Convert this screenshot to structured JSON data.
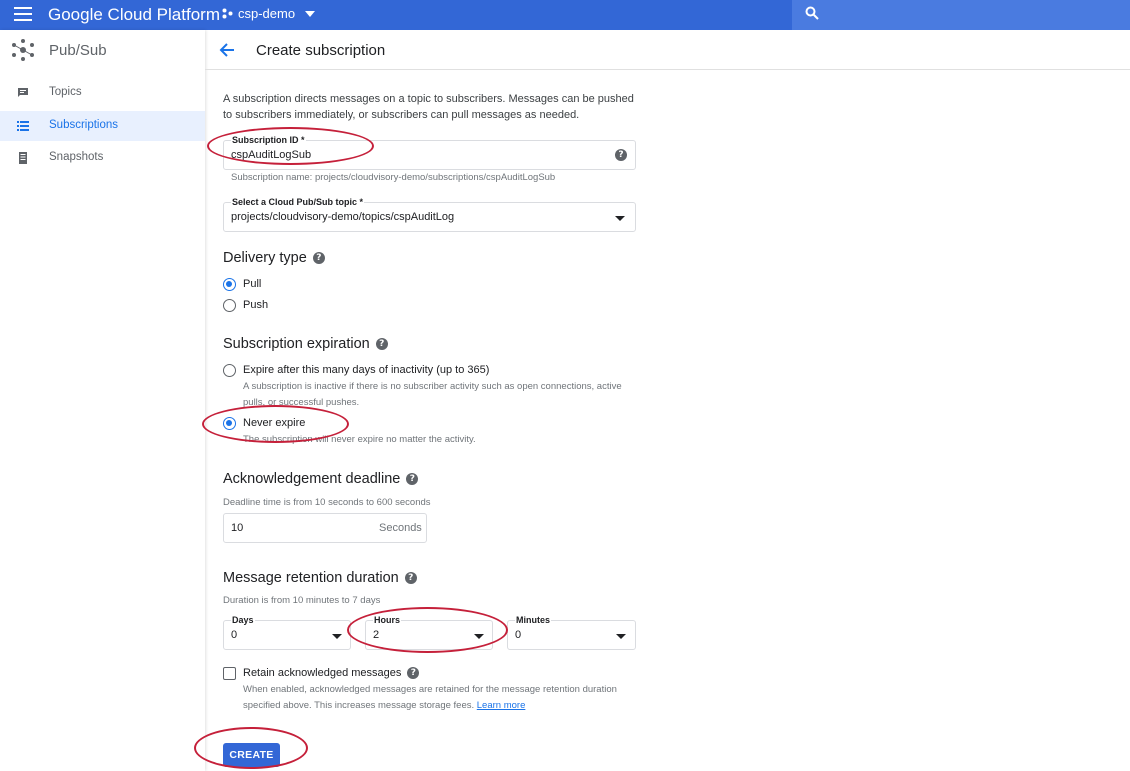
{
  "topbar": {
    "brand": "Google Cloud Platform",
    "project": "csp-demo"
  },
  "sidebar": {
    "product": "Pub/Sub",
    "items": [
      {
        "label": "Topics",
        "icon": "message-icon",
        "active": false
      },
      {
        "label": "Subscriptions",
        "icon": "list-icon",
        "active": true
      },
      {
        "label": "Snapshots",
        "icon": "snapshot-icon",
        "active": false
      }
    ]
  },
  "header": {
    "title": "Create subscription"
  },
  "form": {
    "intro": "A subscription directs messages on a topic to subscribers. Messages can be pushed to subscribers immediately, or subscribers can pull messages as needed.",
    "subscription_id": {
      "label": "Subscription ID *",
      "value": "cspAuditLogSub",
      "hint": "Subscription name: projects/cloudvisory-demo/subscriptions/cspAuditLogSub"
    },
    "topic": {
      "label": "Select a Cloud Pub/Sub topic *",
      "value": "projects/cloudvisory-demo/topics/cspAuditLog"
    },
    "delivery": {
      "title": "Delivery type",
      "options": [
        "Pull",
        "Push"
      ],
      "selected": "Pull"
    },
    "expiration": {
      "title": "Subscription expiration",
      "option1": "Expire after this many days of inactivity (up to 365)",
      "option1_desc": "A subscription is inactive if there is no subscriber activity such as open connections, active pulls, or successful pushes.",
      "option2": "Never expire",
      "option2_desc": "The subscription will never expire no matter the activity.",
      "selected": "Never expire"
    },
    "ack": {
      "title": "Acknowledgement deadline",
      "hint": "Deadline time is from 10 seconds to 600 seconds",
      "value": "10",
      "unit": "Seconds"
    },
    "retention": {
      "title": "Message retention duration",
      "hint": "Duration is from 10 minutes to 7 days",
      "days_label": "Days",
      "days": "0",
      "hours_label": "Hours",
      "hours": "2",
      "minutes_label": "Minutes",
      "minutes": "0"
    },
    "retain": {
      "label": "Retain acknowledged messages",
      "checked": false,
      "desc": "When enabled, acknowledged messages are retained for the message retention duration specified above. This increases message storage fees.",
      "learn_more": "Learn more"
    },
    "create_label": "CREATE"
  },
  "colors": {
    "topbar": "#3367d6",
    "accent": "#1a73e8",
    "annotation": "#c5203a"
  }
}
